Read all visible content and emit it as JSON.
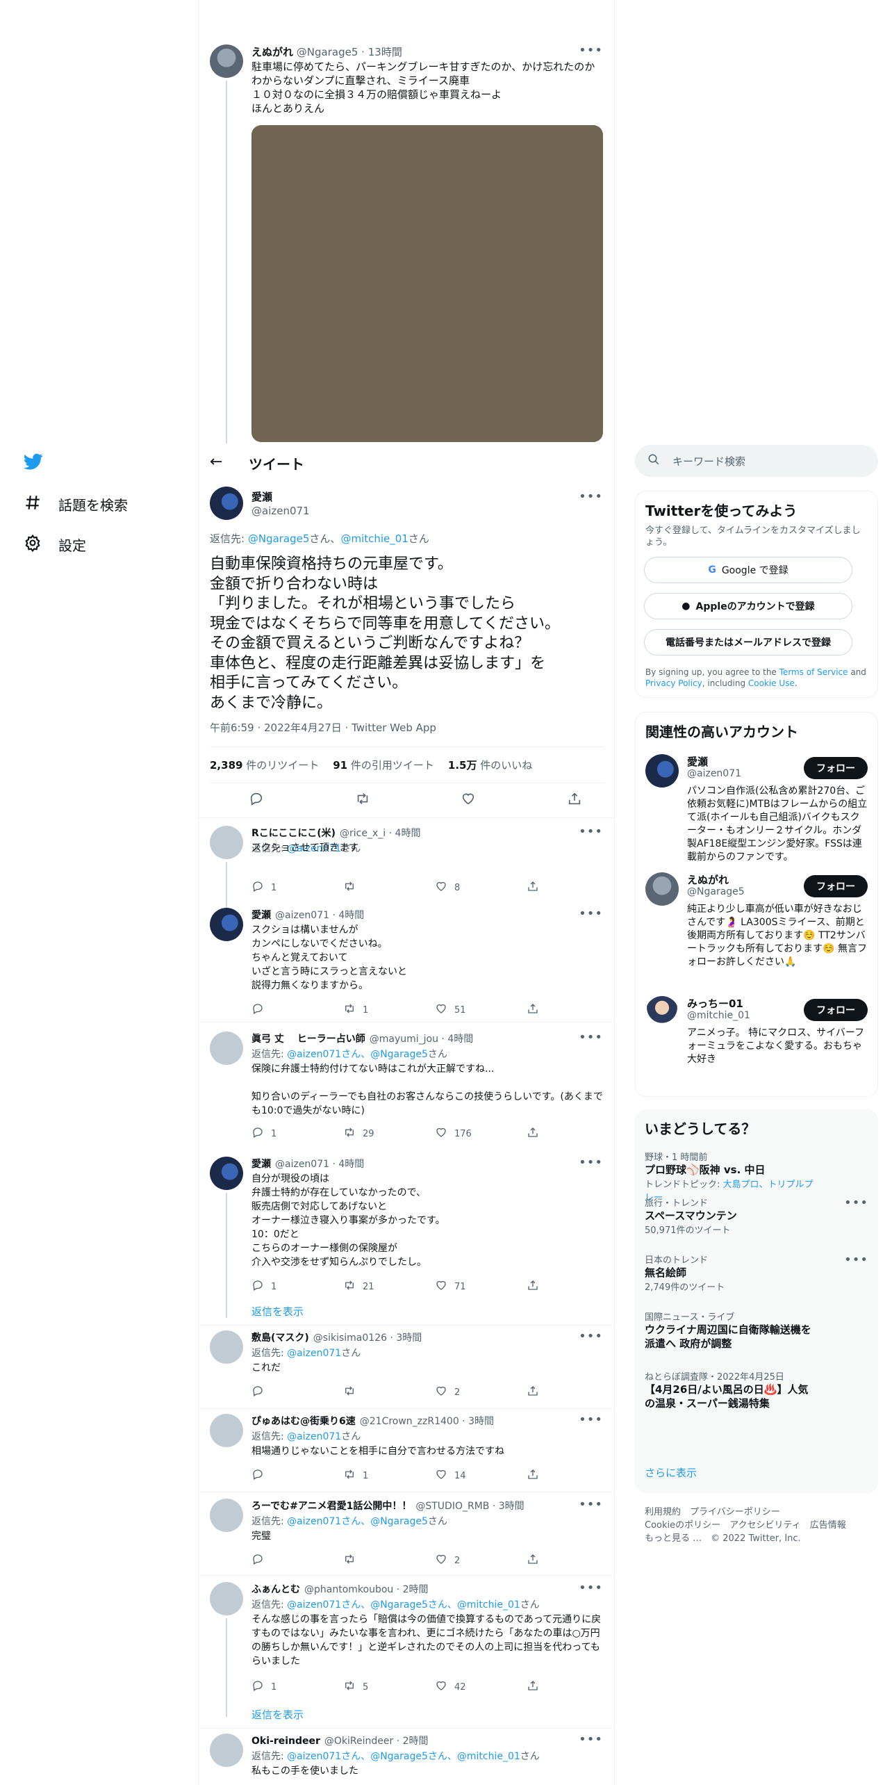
{
  "nav": {
    "items": [
      {
        "label": "話題を検索",
        "icon": "hashtag-icon"
      },
      {
        "label": "設定",
        "icon": "gear-icon"
      }
    ]
  },
  "header": {
    "title": "ツイート"
  },
  "parent_tweet": {
    "name": "えぬがれ",
    "handle": "@Ngarage5",
    "time": "13時間",
    "text": "駐車場に停めてたら、パーキングブレーキ甘すぎたのか、かけ忘れたのか\nわからないダンプに直撃され、ミライース廃車\n１０対０なのに全損３４万の賠償額じゃ車買えねーよ\nほんとありえん",
    "media_color": "#6f6550"
  },
  "main_tweet": {
    "name": "愛瀬",
    "handle": "@aizen071",
    "reply_prefix": "返信先: ",
    "reply_to_1": "@Ngarage5",
    "reply_mid": "さん、",
    "reply_to_2": "@mitchie_01",
    "reply_suffix": "さん",
    "text": "自動車保険資格持ちの元車屋です。\n金額で折り合わない時は\n「判りました。それが相場という事でしたら\n現金ではなくそちらで同等車を用意してください。\nその金額で買えるというご判断なんですよね？\n車体色と、程度の走行距離差異は妥協します」を\n相手に言ってみてください。\nあくまで冷静に。",
    "timestamp": "午前6:59 · 2022年4月27日 · Twitter Web App",
    "retweets": "2,389",
    "retweets_label": " 件のリツイート",
    "quotes": "91",
    "quotes_label": " 件の引用ツイート",
    "likes": "1.5万",
    "likes_label": " 件のいいね"
  },
  "replies": [
    {
      "name": "Rこにここにこ(米)",
      "handle": "@rice_x_i",
      "time": "4時間",
      "reply_to": "返信先: ",
      "reply_handles": "@aizen071",
      "reply_suffix": "さん",
      "text": "スクショさせて頂きます",
      "replies": "1",
      "retweets": "",
      "likes": "8"
    },
    {
      "name": "愛瀬",
      "handle": "@aizen071",
      "time": "4時間",
      "reply_to": "",
      "reply_handles": "",
      "reply_suffix": "",
      "text": "スクショは構いませんが\nカンペにしないでくださいね。\nちゃんと覚えておいて\nいざと言う時にスラっと言えないと\n説得力無くなりますから。",
      "replies": "",
      "retweets": "1",
      "likes": "51"
    },
    {
      "name": "眞弓 丈　 ヒーラー占い師",
      "handle": "@mayumi_jou",
      "time": "4時間",
      "reply_to": "返信先: ",
      "reply_handles": "@aizen071さん、@Ngarage5",
      "reply_suffix": "さん",
      "text": "保険に弁護士特約付けてない時はこれが大正解ですね...\n\n知り合いのディーラーでも自社のお客さんならこの技使うらしいです。(あくまでも10:0で過失がない時に)",
      "replies": "1",
      "retweets": "29",
      "likes": "176"
    },
    {
      "name": "愛瀬",
      "handle": "@aizen071",
      "time": "4時間",
      "reply_to": "",
      "reply_handles": "",
      "reply_suffix": "",
      "text": "自分が現役の頃は\n弁護士特約が存在していなかったので、\n販売店側で対応してあげないと\nオーナー様泣き寝入り事案が多かったです。\n10：0だと\nこちらのオーナー様側の保険屋が\n介入や交渉をせず知らんぷりでしたし。",
      "replies": "1",
      "retweets": "21",
      "likes": "71",
      "show_replies": "返信を表示"
    },
    {
      "name": "敷島(マスク)",
      "handle": "@sikisima0126",
      "time": "3時間",
      "reply_to": "返信先: ",
      "reply_handles": "@aizen071",
      "reply_suffix": "さん",
      "text": "これだ",
      "replies": "",
      "retweets": "",
      "likes": "2"
    },
    {
      "name": "ぴゅあはむ@街乗り6速",
      "handle": "@21Crown_zzR1400",
      "time": "3時間",
      "reply_to": "返信先: ",
      "reply_handles": "@aizen071",
      "reply_suffix": "さん",
      "text": "相場通りじゃないことを相手に自分で言わせる方法ですね",
      "replies": "",
      "retweets": "1",
      "likes": "14"
    },
    {
      "name": "ろーでむ#アニメ君愛1話公開中！！",
      "handle": "@STUDIO_RMB",
      "time": "3時間",
      "reply_to": "返信先: ",
      "reply_handles": "@aizen071さん、@Ngarage5",
      "reply_suffix": "さん",
      "text": "完璧",
      "replies": "",
      "retweets": "",
      "likes": "2"
    },
    {
      "name": "ふぁんとむ",
      "handle": "@phantomkoubou",
      "time": "2時間",
      "reply_to": "返信先: ",
      "reply_handles": "@aizen071さん、@Ngarage5さん、@mitchie_01",
      "reply_suffix": "さん",
      "text": "そんな感じの事を言ったら「賠償は今の価値で換算するものであって元通りに戻すものではない」みたいな事を言われ、更にゴネ続けたら「あなたの車は○万円の勝ちしか無いんです！」と逆ギレされたのでその人の上司に担当を代わってもらいました",
      "replies": "1",
      "retweets": "5",
      "likes": "42",
      "show_replies": "返信を表示"
    },
    {
      "name": "Oki-reindeer",
      "handle": "@OkiReindeer",
      "time": "2時間",
      "reply_to": "返信先: ",
      "reply_handles": "@aizen071さん、@Ngarage5さん、@mitchie_01",
      "reply_suffix": "さん",
      "text": "私もこの手を使いました",
      "replies": "",
      "retweets": "",
      "likes": ""
    }
  ],
  "sidebar": {
    "search_placeholder": "キーワード検索",
    "signup": {
      "title": "Twitterを使ってみよう",
      "subtitle": "今すぐ登録して、タイムラインをカスタマイズしましょう。",
      "google": "Google で登録",
      "apple": "Appleのアカウントで登録",
      "phone": "電話番号またはメールアドレスで登録",
      "legal_1": "By signing up, you agree to the ",
      "terms": "Terms of Service",
      "legal_2": " and ",
      "privacy": "Privacy Policy",
      "legal_3": ", including ",
      "cookie": "Cookie Use",
      "legal_4": "."
    },
    "relevant": {
      "title": "関連性の高いアカウント",
      "follow_label": "フォロー",
      "accounts": [
        {
          "name": "愛瀬",
          "handle": "@aizen071",
          "bio": "パソコン自作派(公私含め累計270台、ご依頼お気軽に)MTBはフレームからの組立て派(ホイールも自己組派)バイクもスクーター・もオンリー２サイクル。ホンダ製AF18E縦型エンジン愛好家。FSSは連載前からのファンです。"
        },
        {
          "name": "えぬがれ",
          "handle": "@Ngarage5",
          "bio": "純正より少し車高が低い車が好きなおじさんです🤰 LA300Sミライース、前期と後期両方所有しております☺️ TT2サンバートラックも所有しております☺️ 無言フォローお許しください🙏"
        },
        {
          "name": "みっちー01",
          "handle": "@mitchie_01",
          "bio": "アニメっ子。 特にマクロス、サイバーフォーミュラをこよなく愛する。おもちゃ大好き"
        }
      ]
    },
    "trends": {
      "title": "いまどうしてる？",
      "items": [
        {
          "category": "野球・1 時間前",
          "name": "プロ野球⚾️阪神 vs. 中日",
          "extra_prefix": "トレンドトピック: ",
          "extra_links": "大島プロ、トリプルプレー",
          "count": ""
        },
        {
          "category": "旅行・トレンド",
          "name": "スペースマウンテン",
          "extra_prefix": "",
          "extra_links": "",
          "count": "50,971件のツイート"
        },
        {
          "category": "日本のトレンド",
          "name": "無名絵師",
          "extra_prefix": "",
          "extra_links": "",
          "count": "2,749件のツイート"
        },
        {
          "category": "国際ニュース・ライブ",
          "name": "ウクライナ周辺国に自衛隊輸送機を派遣へ 政府が調整",
          "extra_prefix": "",
          "extra_links": "",
          "count": ""
        },
        {
          "category": "ねとらぼ調査隊・2022年4月25日",
          "name": "【4月26日/よい風呂の日♨️】人気の温泉・スーパー銭湯特集",
          "extra_prefix": "",
          "extra_links": "",
          "count": ""
        }
      ],
      "show_more": "さらに表示"
    },
    "footer": {
      "row1": "利用規約　プライバシーポリシー",
      "row2": "Cookieのポリシー　アクセシビリティ　広告情報",
      "row3": "もっと見る …　© 2022 Twitter, Inc."
    }
  }
}
